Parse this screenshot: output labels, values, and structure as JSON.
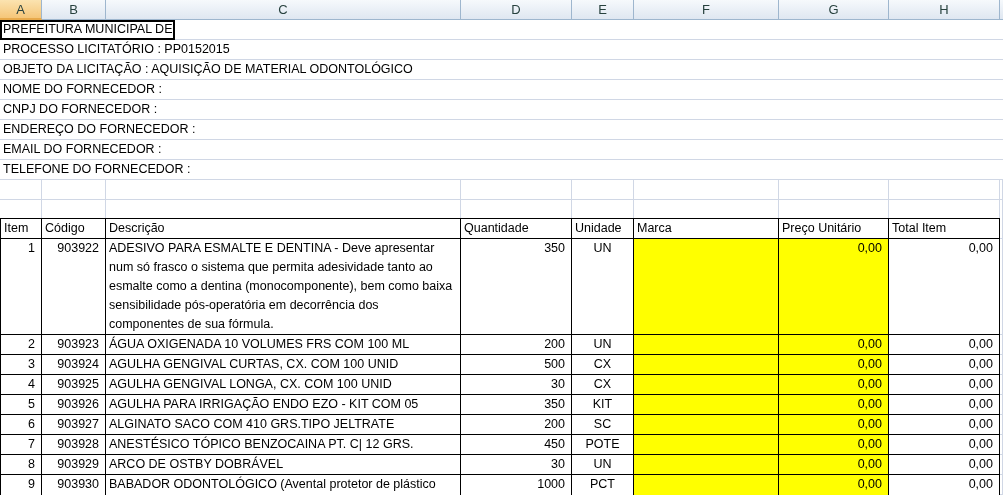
{
  "sheet": {
    "column_headers": [
      {
        "label": "A",
        "selected": true
      },
      {
        "label": "B",
        "selected": false
      },
      {
        "label": "C",
        "selected": false
      },
      {
        "label": "D",
        "selected": false
      },
      {
        "label": "E",
        "selected": false
      },
      {
        "label": "F",
        "selected": false
      },
      {
        "label": "G",
        "selected": false
      },
      {
        "label": "H",
        "selected": false
      }
    ],
    "info_lines": [
      {
        "text": "PREFEITURA MUNICIPAL DE",
        "active_cell": true
      },
      {
        "text": "PROCESSO LICITATÓRIO : PP0152015",
        "active_cell": false
      },
      {
        "text": "OBJETO DA LICITAÇÃO : AQUISIÇÃO DE MATERIAL ODONTOLÓGICO",
        "active_cell": false
      },
      {
        "text": "NOME DO FORNECEDOR :",
        "active_cell": false
      },
      {
        "text": "CNPJ DO FORNECEDOR :",
        "active_cell": false
      },
      {
        "text": "ENDEREÇO DO FORNECEDOR :",
        "active_cell": false
      },
      {
        "text": "EMAIL DO FORNECEDOR :",
        "active_cell": false
      },
      {
        "text": "TELEFONE DO FORNECEDOR :",
        "active_cell": false
      }
    ],
    "table": {
      "columns": [
        {
          "label": "Item",
          "highlighted": false
        },
        {
          "label": "Código",
          "highlighted": false
        },
        {
          "label": "Descrição",
          "highlighted": false
        },
        {
          "label": "Quantidade",
          "highlighted": false
        },
        {
          "label": "Unidade",
          "highlighted": false
        },
        {
          "label": "Marca",
          "highlighted": true
        },
        {
          "label": "Preço Unitário",
          "highlighted": true
        },
        {
          "label": "Total Item",
          "highlighted": false
        }
      ],
      "rows": [
        {
          "cells": [
            "1",
            "903922",
            "ADESIVO PARA ESMALTE E DENTINA - Deve apresentar num só frasco o sistema que permita adesividade tanto ao esmalte como a dentina (monocomponente), bem como baixa sensibilidade pós-operatória em decorrência dos componentes de sua fórmula.",
            "350",
            "UN",
            null,
            "0,00",
            "0,00"
          ]
        },
        {
          "cells": [
            "2",
            "903923",
            "ÁGUA OXIGENADA 10 VOLUMES FRS COM 100 ML",
            "200",
            "UN",
            null,
            "0,00",
            "0,00"
          ]
        },
        {
          "cells": [
            "3",
            "903924",
            "AGULHA GENGIVAL CURTAS, CX. COM 100 UNID",
            "500",
            "CX",
            null,
            "0,00",
            "0,00"
          ]
        },
        {
          "cells": [
            "4",
            "903925",
            "AGULHA GENGIVAL LONGA, CX. COM 100 UNID",
            "30",
            "CX",
            null,
            "0,00",
            "0,00"
          ]
        },
        {
          "cells": [
            "5",
            "903926",
            "AGULHA PARA IRRIGAÇÃO ENDO EZO - KIT COM 05",
            "350",
            "KIT",
            null,
            "0,00",
            "0,00"
          ]
        },
        {
          "cells": [
            "6",
            "903927",
            "ALGINATO SACO COM 410 GRS.TIPO JELTRATE",
            "200",
            "SC",
            null,
            "0,00",
            "0,00"
          ]
        },
        {
          "cells": [
            "7",
            "903928",
            "ANESTÉSICO TÓPICO BENZOCAINA PT. C| 12 GRS.",
            "450",
            "POTE",
            null,
            "0,00",
            "0,00"
          ]
        },
        {
          "cells": [
            "8",
            "903929",
            "ARCO DE OSTBY DOBRÁVEL",
            "30",
            "UN",
            null,
            "0,00",
            "0,00"
          ]
        },
        {
          "cells": [
            "9",
            "903930",
            "BABADOR ODONTOLÓGICO (Avental protetor de plástico",
            "1000",
            "PCT",
            null,
            "0,00",
            "0,00"
          ]
        }
      ]
    }
  }
}
